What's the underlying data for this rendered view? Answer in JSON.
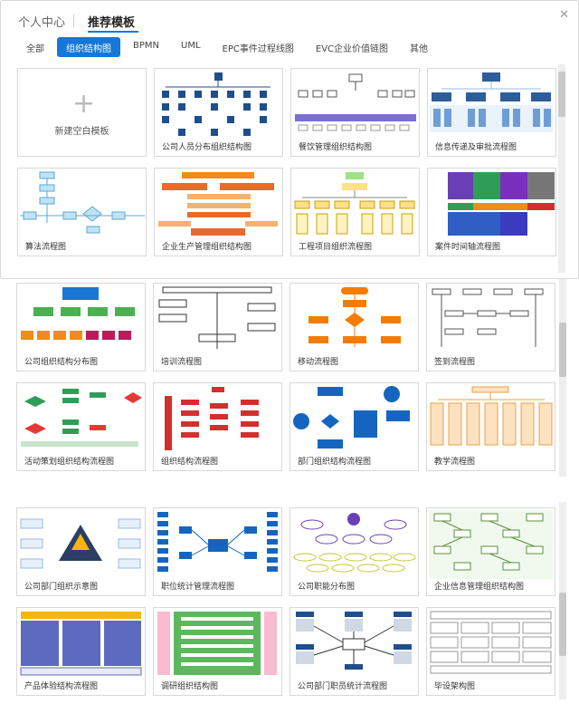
{
  "header": {
    "tab_personal": "个人中心",
    "tab_recommend": "推荐模板",
    "close_icon": "close-icon"
  },
  "categories": [
    "全部",
    "组织结构图",
    "BPMN",
    "UML",
    "EPC事件过程线图",
    "EVC企业价值链图",
    "其他"
  ],
  "active_category": "组织结构图",
  "blank_template": {
    "label": "新建空白模板"
  },
  "panel1": {
    "cards": [
      "公司人员分布组织结构图",
      "餐饮管理组织结构图",
      "信息传递及审批流程图",
      "算法流程图",
      "企业生产管理组织结构图",
      "工程项目组织流程图",
      "案件时间轴流程图"
    ]
  },
  "panel2": {
    "cards": [
      "公司组织结构分布图",
      "培训流程图",
      "移动流程图",
      "签到流程图",
      "活动策划组织结构流程图",
      "组织结构流程图",
      "部门组织结构流程图",
      "教学流程图"
    ]
  },
  "panel3": {
    "cards": [
      "公司部门组织示意图",
      "职位统计管理流程图",
      "公司职能分布图",
      "企业信息管理组织结构图",
      "产品体验结构流程图",
      "调研组织结构图",
      "公司部门职员统计流程图",
      "毕设架构图"
    ]
  },
  "colors": {
    "accent": "#1677d9",
    "navy": "#1f4e8c",
    "green": "#4caf50",
    "orange": "#f08c1a",
    "red": "#d32f2f",
    "purple": "#6a3fb5"
  }
}
